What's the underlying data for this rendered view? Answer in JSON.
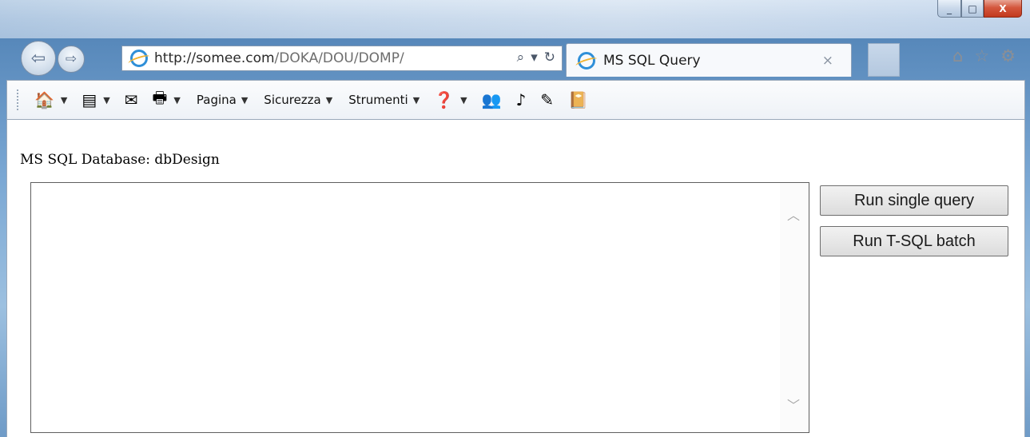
{
  "window": {
    "minimize_glyph": "_",
    "maximize_glyph": "□",
    "close_glyph": "X"
  },
  "navigation": {
    "back_glyph": "⇦",
    "forward_glyph": "⇨",
    "url_host": "http://somee.com",
    "url_path": "/DOKA/DOU/DOMP/",
    "search_glyph": "⌕",
    "dropdown_glyph": "▾",
    "refresh_glyph": "↻"
  },
  "tab": {
    "title": "MS SQL Query",
    "close_glyph": "×"
  },
  "right_icons": {
    "home": "⌂",
    "favorites": "☆",
    "tools": "⚙"
  },
  "command_bar": {
    "home_icon": "🏠",
    "feeds_icon": "▤",
    "mail_icon": "✉",
    "print_icon": "🖶",
    "caret": "▼",
    "page_label": "Pagina",
    "safety_label": "Sicurezza",
    "tools_label": "Strumenti",
    "help_icon": "❓",
    "ext_icons": [
      "👥",
      "♪",
      "✎",
      "📔"
    ]
  },
  "page": {
    "db_label": "MS SQL Database: dbDesign",
    "query_text": "",
    "scroll_up_glyph": "︿",
    "scroll_down_glyph": "﹀",
    "run_single_label": "Run single query",
    "run_batch_label": "Run T-SQL batch"
  }
}
